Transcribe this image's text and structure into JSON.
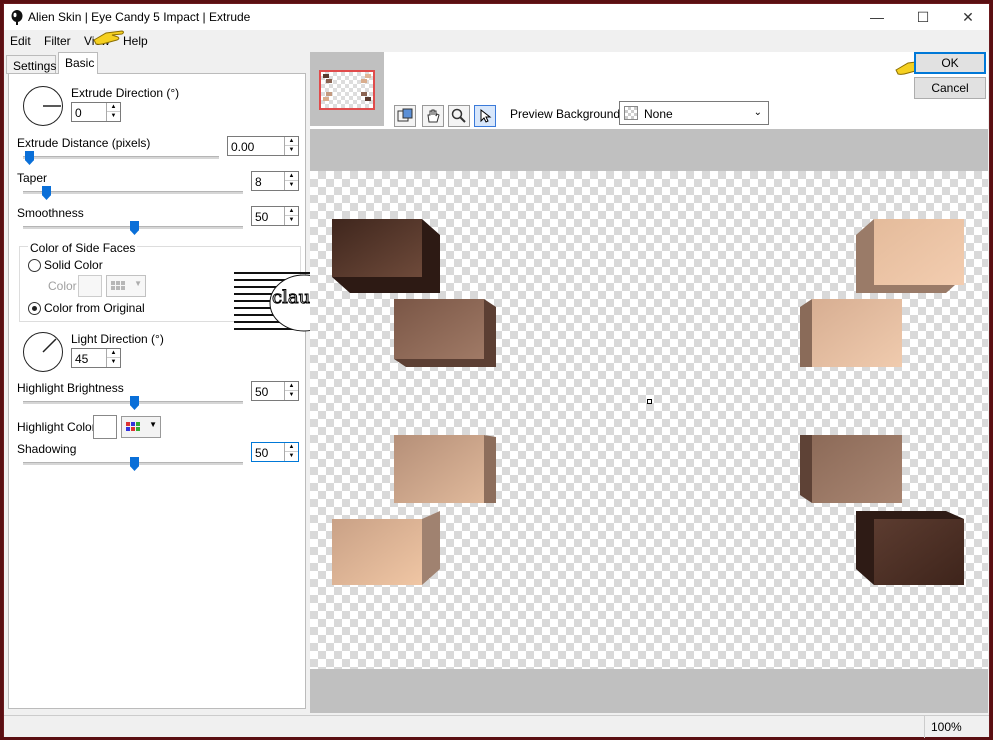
{
  "window": {
    "title": "Alien Skin | Eye Candy 5 Impact | Extrude",
    "minimize": "—",
    "maximize": "☐",
    "close": "✕"
  },
  "menu": [
    "Edit",
    "Filter",
    "View",
    "Help"
  ],
  "tabs": [
    {
      "label": "Settings",
      "active": false
    },
    {
      "label": "Basic",
      "active": true
    }
  ],
  "basic": {
    "extrude_direction": {
      "label": "Extrude Direction (°)",
      "value": "0"
    },
    "extrude_distance": {
      "label": "Extrude Distance (pixels)",
      "value": "0.00",
      "slider": 0
    },
    "taper": {
      "label": "Taper",
      "value": "8",
      "slider": 8
    },
    "smoothness": {
      "label": "Smoothness",
      "value": "50",
      "slider": 50
    },
    "side_faces": {
      "group_label": "Color of Side Faces",
      "solid_label": "Solid Color",
      "color_label": "Color",
      "original_label": "Color from Original",
      "selected": "original"
    },
    "light_direction": {
      "label": "Light Direction (°)",
      "value": "45"
    },
    "highlight_brightness": {
      "label": "Highlight Brightness",
      "value": "50",
      "slider": 50
    },
    "highlight_color": {
      "label": "Highlight Color",
      "color": "#ffffff"
    },
    "shadowing": {
      "label": "Shadowing",
      "value": "50",
      "slider": 50
    }
  },
  "preview": {
    "background_label": "Preview Background:",
    "background_value": "None",
    "tools": [
      "preview-navigate-icon",
      "hand-icon",
      "zoom-icon",
      "pointer-icon"
    ]
  },
  "buttons": {
    "ok": "OK",
    "cancel": "Cancel"
  },
  "status": {
    "zoom": "100%"
  },
  "watermark_text": "claudia",
  "colors": {
    "accent": "#0078d7",
    "frame": "#5a0f12",
    "dark_brown": "#4a2e24",
    "light_peach": "#e8bb98"
  }
}
